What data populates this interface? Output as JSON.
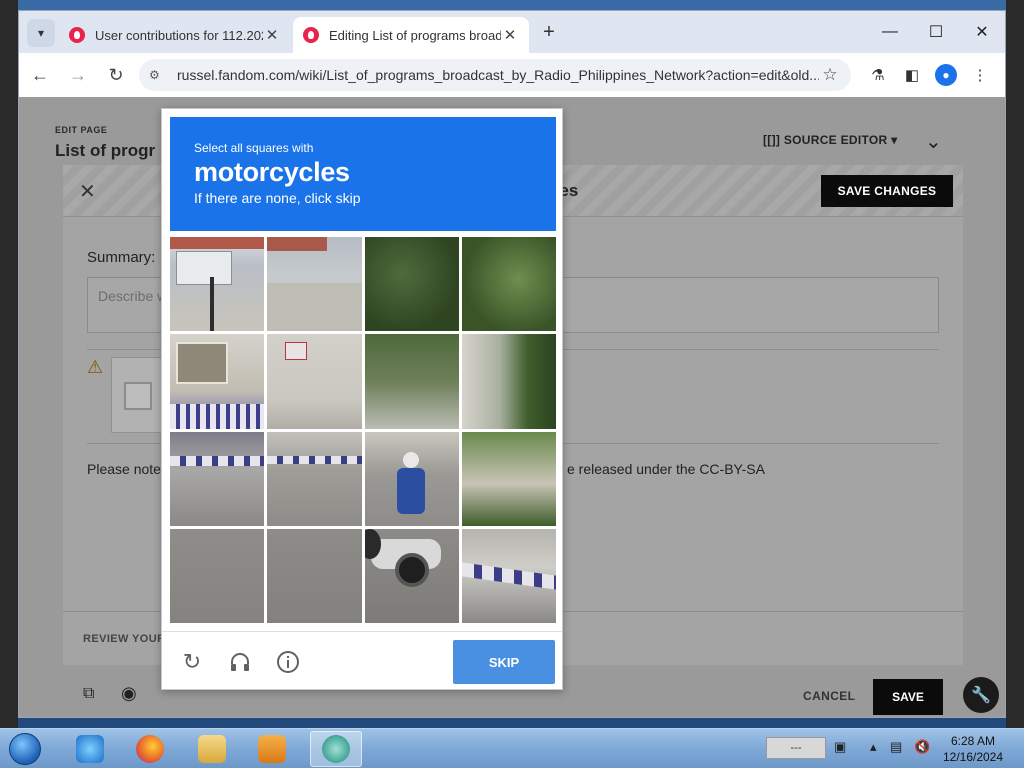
{
  "browser": {
    "tabs": [
      {
        "title": "User contributions for 112.202",
        "active": false
      },
      {
        "title": "Editing List of programs broad",
        "active": true
      }
    ],
    "url": "russel.fandom.com/wiki/List_of_programs_broadcast_by_Radio_Philippines_Network?action=edit&old..."
  },
  "page": {
    "eyebrow": "EDIT PAGE",
    "title": "List of progr",
    "source_editor": "[[]] SOURCE EDITOR ▾",
    "modal": {
      "title_partial": "ges",
      "save_changes": "SAVE CHANGES",
      "summary_label": "Summary:",
      "summary_placeholder": "Describe w",
      "notice_left": "Please note",
      "notice_right": "e released under the CC-BY-SA",
      "review": "REVIEW YOUR"
    },
    "cancel": "CANCEL",
    "save": "SAVE"
  },
  "recaptcha": {
    "instruction": "Select all squares with",
    "target": "motorcycles",
    "hint": "If there are none, click skip",
    "skip": "SKIP"
  },
  "taskbar": {
    "time": "6:28 AM",
    "date": "12/16/2024",
    "tray_box": "---"
  }
}
